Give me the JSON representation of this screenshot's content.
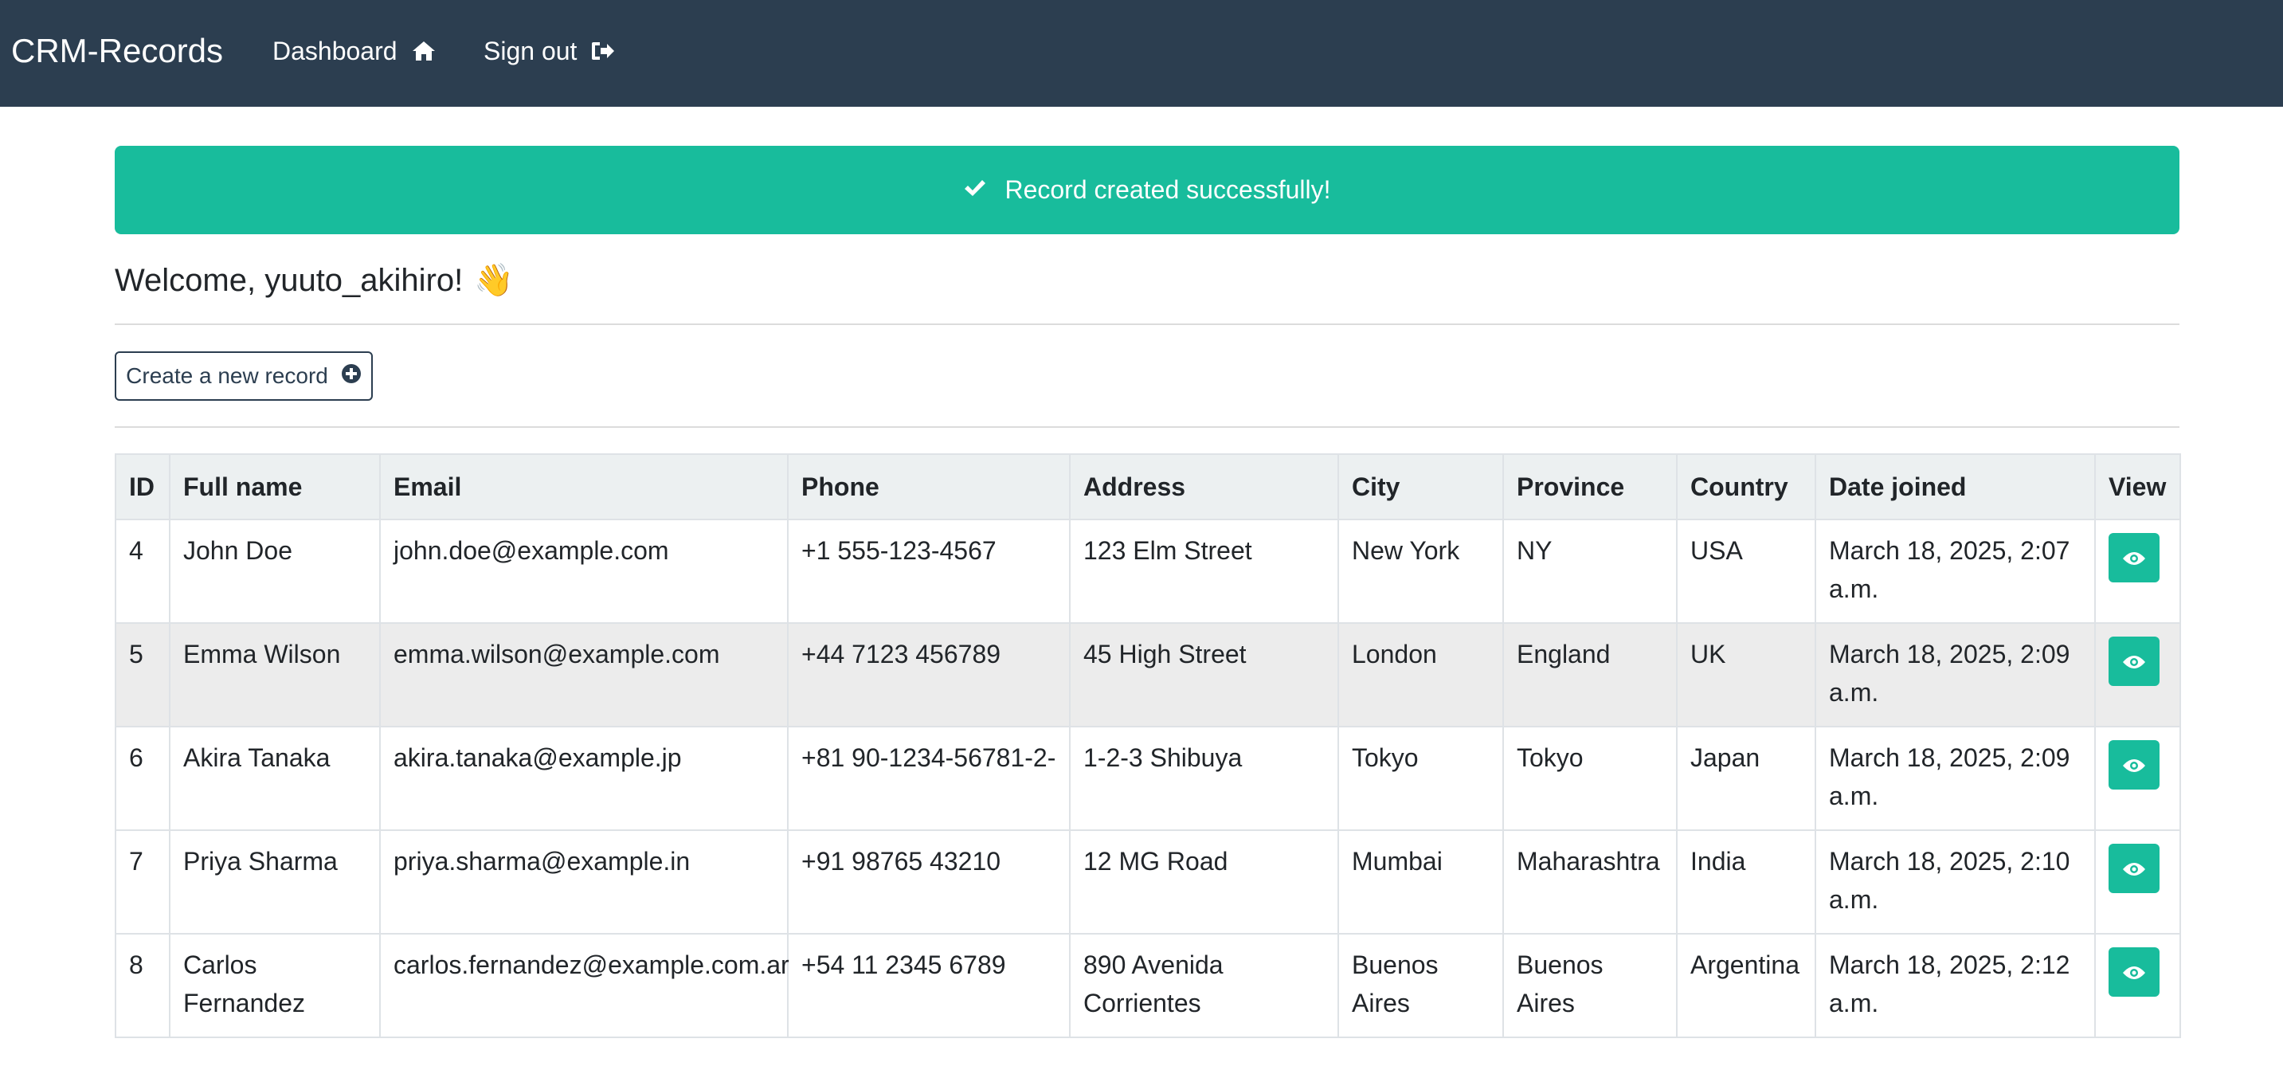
{
  "navbar": {
    "brand": "CRM-Records",
    "links": [
      {
        "label": "Dashboard",
        "icon": "home-icon"
      },
      {
        "label": "Sign out",
        "icon": "sign-out-icon"
      }
    ],
    "background": "#2c3e50"
  },
  "alert": {
    "message": "Record created successfully!",
    "icon": "check-icon",
    "color": "#18bc9c"
  },
  "welcome": {
    "text": "Welcome, yuuto_akihiro!",
    "emoji": "👋"
  },
  "create_button": {
    "label": "Create a new record",
    "icon": "plus-circle-icon"
  },
  "table": {
    "headers": [
      "ID",
      "Full name",
      "Email",
      "Phone",
      "Address",
      "City",
      "Province",
      "Country",
      "Date joined",
      "View"
    ],
    "rows": [
      {
        "id": "4",
        "name": "John Doe",
        "email": "john.doe@example.com",
        "phone": "+1 555-123-4567",
        "address": "123 Elm Street",
        "city": "New York",
        "province": "NY",
        "country": "USA",
        "date": "March 18, 2025, 2:07 a.m."
      },
      {
        "id": "5",
        "name": "Emma Wilson",
        "email": "emma.wilson@example.com",
        "phone": "+44 7123 456789",
        "address": "45 High Street",
        "city": "London",
        "province": "England",
        "country": "UK",
        "date": "March 18, 2025, 2:09 a.m."
      },
      {
        "id": "6",
        "name": "Akira Tanaka",
        "email": "akira.tanaka@example.jp",
        "phone": "+81 90-1234-56781-2-",
        "address": "1-2-3 Shibuya",
        "city": "Tokyo",
        "province": "Tokyo",
        "country": "Japan",
        "date": "March 18, 2025, 2:09 a.m."
      },
      {
        "id": "7",
        "name": "Priya Sharma",
        "email": "priya.sharma@example.in",
        "phone": "+91 98765 43210",
        "address": "12 MG Road",
        "city": "Mumbai",
        "province": "Maharashtra",
        "country": "India",
        "date": "March 18, 2025, 2:10 a.m."
      },
      {
        "id": "8",
        "name": "Carlos Fernandez",
        "email": "carlos.fernandez@example.com.ar",
        "phone": "+54 11 2345 6789",
        "address": "890 Avenida Corrientes",
        "city": "Buenos Aires",
        "province": "Buenos Aires",
        "country": "Argentina",
        "date": "March 18, 2025, 2:12 a.m."
      }
    ],
    "view_icon": "eye-icon",
    "view_button_color": "#18bc9c",
    "header_background": "#ecf0f1"
  }
}
